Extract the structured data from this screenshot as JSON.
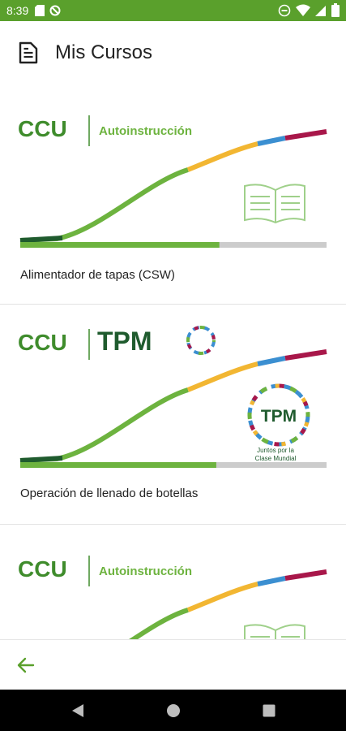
{
  "status_bar": {
    "time": "8:39"
  },
  "header": {
    "title": "Mis Cursos"
  },
  "courses": [
    {
      "label": "Alimentador de tapas (CSW)",
      "brand": "CCU",
      "tag": "Autoinstrucción",
      "progress": 0.65
    },
    {
      "label": "Operación de llenado de botellas",
      "brand": "CCU",
      "tag": "TPM",
      "badge": "TPM",
      "badge_caption_1": "Juntos por la",
      "badge_caption_2": "Clase Mundial",
      "progress": 0.64
    },
    {
      "label": "",
      "brand": "CCU",
      "tag": "Autoinstrucción"
    }
  ],
  "colors": {
    "status_bar": "#5aa02c",
    "brand_green": "#3f8c2c",
    "curve_green": "#6db33f",
    "curve_yellow": "#f2b632",
    "curve_blue": "#3b8fd1",
    "curve_red": "#a8174a",
    "dark_green": "#1f5b2e"
  }
}
